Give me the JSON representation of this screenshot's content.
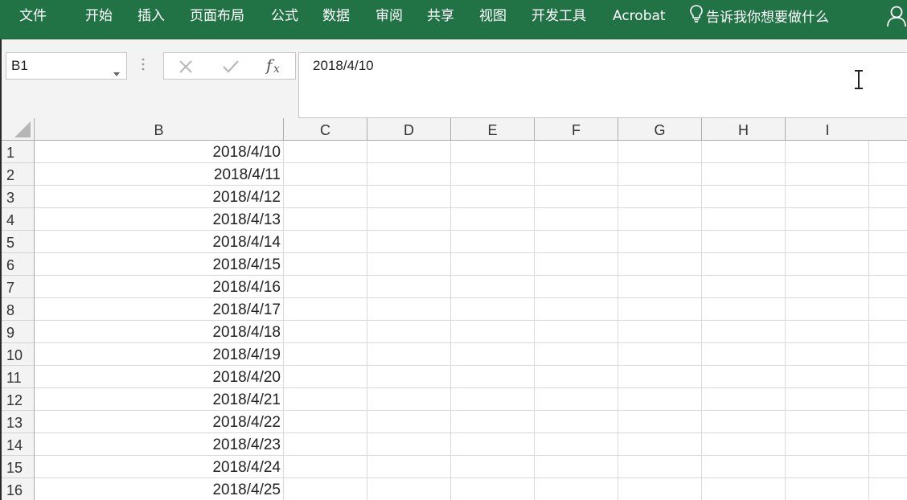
{
  "ribbon": {
    "tabs": [
      "文件",
      "开始",
      "插入",
      "页面布局",
      "公式",
      "数据",
      "审阅",
      "共享",
      "视图",
      "开发工具",
      "Acrobat"
    ],
    "tell_me": "告诉我你想要做什么",
    "bg_color": "#217346"
  },
  "formula_bar": {
    "name_box": "B1",
    "formula": "2018/4/10"
  },
  "grid": {
    "columns": [
      "B",
      "C",
      "D",
      "E",
      "F",
      "G",
      "H",
      "I"
    ],
    "rows": [
      "1",
      "2",
      "3",
      "4",
      "5",
      "6",
      "7",
      "8",
      "9",
      "10",
      "11",
      "12",
      "13",
      "14",
      "15",
      "16"
    ],
    "column_b_values": [
      "2018/4/10",
      "2018/4/11",
      "2018/4/12",
      "2018/4/13",
      "2018/4/14",
      "2018/4/15",
      "2018/4/16",
      "2018/4/17",
      "2018/4/18",
      "2018/4/19",
      "2018/4/20",
      "2018/4/21",
      "2018/4/22",
      "2018/4/23",
      "2018/4/24",
      "2018/4/25"
    ]
  }
}
